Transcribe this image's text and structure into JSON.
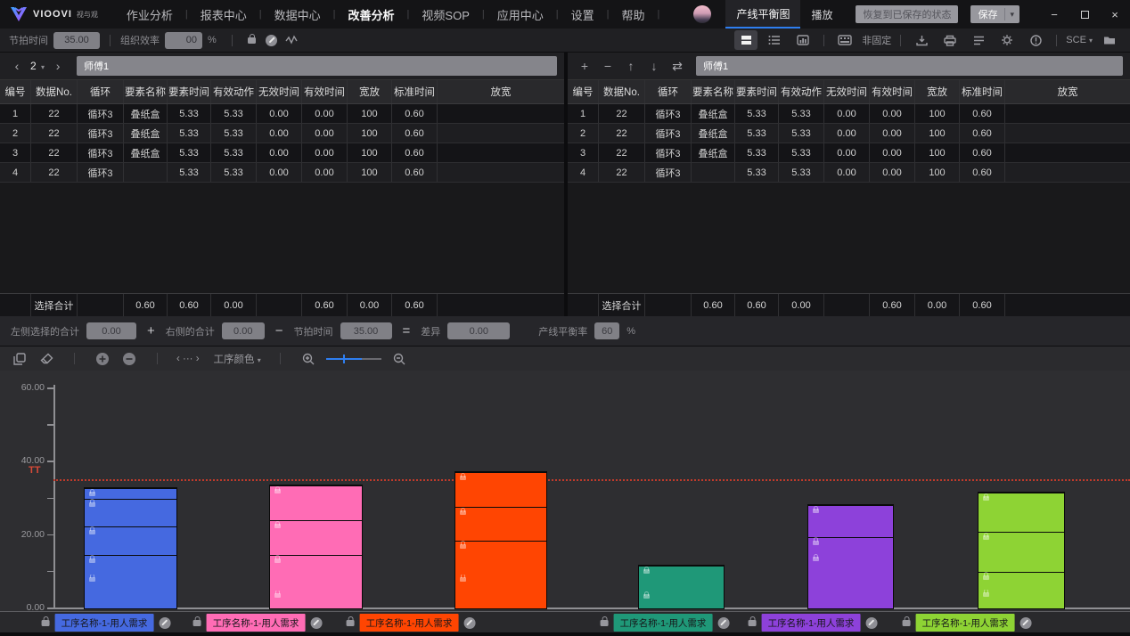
{
  "menubar": {
    "brand": {
      "name": "VIOOVI",
      "cn": "视与观"
    },
    "items": [
      {
        "label": "作业分析",
        "active": false
      },
      {
        "label": "报表中心",
        "active": false
      },
      {
        "label": "数据中心",
        "active": false
      },
      {
        "label": "改善分析",
        "active": true
      },
      {
        "label": "视频SOP",
        "active": false
      },
      {
        "label": "应用中心",
        "active": false
      },
      {
        "label": "设置",
        "active": false
      },
      {
        "label": "帮助",
        "active": false
      }
    ],
    "tabs": [
      {
        "label": "产线平衡图",
        "active": true
      },
      {
        "label": "播放",
        "active": false
      }
    ],
    "restore_button": "恢复到已保存的状态",
    "save_button": "保存"
  },
  "toolbar": {
    "takt_label": "节拍时间",
    "takt_value": "35.00",
    "efficiency_label": "组织效率",
    "efficiency_value": "00",
    "percent": "%",
    "pin_label": "非固定",
    "sce_label": "SCE"
  },
  "left_panel": {
    "pager_value": "2",
    "operator": "师傅1"
  },
  "right_panel": {
    "operator": "师傅1"
  },
  "table": {
    "headers": [
      "编号",
      "数据No.",
      "循环",
      "要素名称",
      "要素时间",
      "有效动作",
      "无效时间",
      "有效时间",
      "宽放",
      "标准时间",
      "放宽"
    ],
    "rows": [
      [
        "1",
        "22",
        "循环3",
        "叠纸盒",
        "5.33",
        "5.33",
        "0.00",
        "0.00",
        "100",
        "0.60",
        ""
      ],
      [
        "2",
        "22",
        "循环3",
        "叠纸盒",
        "5.33",
        "5.33",
        "0.00",
        "0.00",
        "100",
        "0.60",
        ""
      ],
      [
        "3",
        "22",
        "循环3",
        "叠纸盒",
        "5.33",
        "5.33",
        "0.00",
        "0.00",
        "100",
        "0.60",
        ""
      ],
      [
        "4",
        "22",
        "循环3",
        "",
        "5.33",
        "5.33",
        "0.00",
        "0.00",
        "100",
        "0.60",
        ""
      ]
    ],
    "summary": [
      "",
      "选择合计",
      "",
      "0.60",
      "0.60",
      "0.00",
      "",
      "0.60",
      "0.00",
      "0.60",
      ""
    ]
  },
  "formula": {
    "left_sum_label": "左侧选择的合计",
    "left_sum": "0.00",
    "plus": "+",
    "right_sum_label": "右侧的合计",
    "right_sum": "0.00",
    "minus": "−",
    "takt_label": "节拍时间",
    "takt": "35.00",
    "equals": "=",
    "diff_label": "差异",
    "diff": "0.00",
    "balance_label": "产线平衡率",
    "balance": "60",
    "percent": "%"
  },
  "chart_toolbar": {
    "color_label": "工序颜色"
  },
  "chart_data": {
    "type": "stacked-bar",
    "ylim": [
      0,
      60
    ],
    "yticks": [
      {
        "value": 0,
        "label": "0.00"
      },
      {
        "value": 10,
        "label": ""
      },
      {
        "value": 20,
        "label": "20.00"
      },
      {
        "value": 30,
        "label": ""
      },
      {
        "value": 40,
        "label": "40.00"
      },
      {
        "value": 50,
        "label": ""
      },
      {
        "value": 60,
        "label": "60.00"
      }
    ],
    "takt_line": {
      "label": "TT",
      "value": 35,
      "color": "#bf3a2b"
    },
    "bars": [
      {
        "process": "工序名称-1-用人需求",
        "color": "#4569e0",
        "total": 33.1,
        "segments": [
          9.3,
          5.4,
          7.9,
          7.7,
          2.8
        ]
      },
      {
        "process": "工序名称-1-用人需求",
        "color": "#ff6cb5",
        "total": 33.8,
        "segments": [
          4.9,
          9.8,
          9.5,
          9.6
        ]
      },
      {
        "process": "工序名称-1-用人需求",
        "color": "#ff4502",
        "total": 37.5,
        "segments": [
          9.3,
          9.3,
          9.3,
          9.6
        ]
      },
      {
        "process": "工序名称-1-用人需求",
        "color": "#1f9878",
        "total": 12.0,
        "segments": [
          4.6,
          7.4
        ]
      },
      {
        "process": "工序名称-1-用人需求",
        "color": "#8d41da",
        "total": 28.5,
        "segments": [
          14.9,
          4.8,
          8.8
        ]
      },
      {
        "process": "工序名称-1-用人需求",
        "color": "#8ed334",
        "total": 31.9,
        "segments": [
          5.1,
          4.9,
          11.0,
          10.9
        ]
      }
    ],
    "legend_position": "bottom",
    "grid": false
  },
  "icons": {
    "chevron_left": "‹",
    "chevron_right": "›",
    "caret_down": "▾",
    "plus": "+",
    "minus": "−",
    "arrow_up": "↑",
    "arrow_down": "↓",
    "swap": "⇄",
    "expand": "‹ ··· ›",
    "win_min": "−",
    "win_close": "×"
  }
}
